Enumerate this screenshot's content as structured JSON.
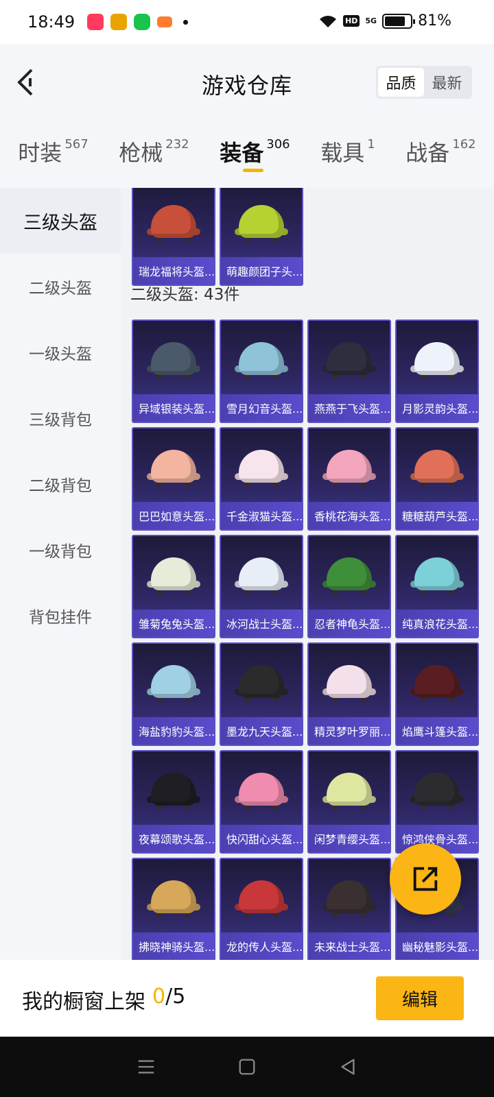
{
  "status_bar": {
    "time": "18:49",
    "battery_percent": "81%",
    "battery_level": 0.81,
    "hd_label": "HD",
    "signal_label": "5G"
  },
  "header": {
    "title": "游戏仓库",
    "sort_options": [
      "品质",
      "最新"
    ],
    "sort_selected": "品质"
  },
  "tabs": [
    {
      "label": "时装",
      "count": "567"
    },
    {
      "label": "枪械",
      "count": "232"
    },
    {
      "label": "装备",
      "count": "306",
      "active": true
    },
    {
      "label": "载具",
      "count": "1"
    },
    {
      "label": "战备",
      "count": "162"
    }
  ],
  "sidebar": {
    "items": [
      {
        "label": "三级头盔",
        "active": true
      },
      {
        "label": "二级头盔"
      },
      {
        "label": "一级头盔"
      },
      {
        "label": "三级背包"
      },
      {
        "label": "二级背包"
      },
      {
        "label": "一级背包"
      },
      {
        "label": "背包挂件"
      }
    ]
  },
  "level3_items": [
    {
      "name": "瑞龙福将头盔...",
      "icon": "dragon-helmet-icon",
      "color": "#c8503a"
    },
    {
      "name": "萌趣颜团子头...",
      "icon": "cute-helmet-icon",
      "color": "#b4d232"
    }
  ],
  "section": {
    "title": "二级头盔: 43件"
  },
  "level2_items": [
    {
      "name": "异域银装头盔...",
      "icon": "helmet-icon",
      "color": "#4a5a6a"
    },
    {
      "name": "雪月幻音头盔...",
      "icon": "helmet-icon",
      "color": "#8fc3d8"
    },
    {
      "name": "燕燕于飞头盔...",
      "icon": "helmet-icon",
      "color": "#2e2e3e"
    },
    {
      "name": "月影灵韵头盔...",
      "icon": "helmet-icon",
      "color": "#eef2fb"
    },
    {
      "name": "巴巴如意头盔...",
      "icon": "helmet-icon",
      "color": "#f3b4a0"
    },
    {
      "name": "千金淑猫头盔...",
      "icon": "helmet-icon",
      "color": "#f7e4ec"
    },
    {
      "name": "香桃花海头盔...",
      "icon": "helmet-icon",
      "color": "#f3a6bd"
    },
    {
      "name": "糖糖葫芦头盔...",
      "icon": "helmet-icon",
      "color": "#e07158"
    },
    {
      "name": "雏菊兔兔头盔...",
      "icon": "helmet-icon",
      "color": "#e6ecd8"
    },
    {
      "name": "冰河战士头盔...",
      "icon": "helmet-icon",
      "color": "#e8eef8"
    },
    {
      "name": "忍者神龟头盔...",
      "icon": "helmet-icon",
      "color": "#3f8e3a"
    },
    {
      "name": "纯真浪花头盔...",
      "icon": "helmet-icon",
      "color": "#7ed0d8"
    },
    {
      "name": "海盐豹豹头盔...",
      "icon": "helmet-icon",
      "color": "#9fd0e4"
    },
    {
      "name": "墨龙九天头盔...",
      "icon": "helmet-icon",
      "color": "#2b2b2b"
    },
    {
      "name": "精灵梦叶罗丽...",
      "icon": "helmet-icon",
      "color": "#f3e0ea"
    },
    {
      "name": "焰鹰斗篷头盔...",
      "icon": "helmet-icon",
      "color": "#5a1e22"
    },
    {
      "name": "夜幕颂歌头盔...",
      "icon": "helmet-icon",
      "color": "#1e1e24"
    },
    {
      "name": "快闪甜心头盔...",
      "icon": "helmet-icon",
      "color": "#f08cb0"
    },
    {
      "name": "闲梦青缨头盔...",
      "icon": "helmet-icon",
      "color": "#dfe6a0"
    },
    {
      "name": "惊鸿侠骨头盔...",
      "icon": "helmet-icon",
      "color": "#2c2c30"
    },
    {
      "name": "拂晓神骑头盔...",
      "icon": "helmet-icon",
      "color": "#d8a85a"
    },
    {
      "name": "龙的传人头盔...",
      "icon": "helmet-icon",
      "color": "#c8383a"
    },
    {
      "name": "未来战士头盔...",
      "icon": "helmet-icon",
      "color": "#3a3032"
    },
    {
      "name": "幽秘魅影头盔...",
      "icon": "helmet-icon",
      "color": "#3a3a5a"
    }
  ],
  "fab": {
    "icon": "share-icon"
  },
  "footer": {
    "showcase_label": "我的橱窗上架",
    "showcase_current": "0",
    "showcase_total": "/5",
    "edit_label": "编辑"
  },
  "colors": {
    "accent": "#fbb514",
    "card_border": "#5c50c4"
  }
}
